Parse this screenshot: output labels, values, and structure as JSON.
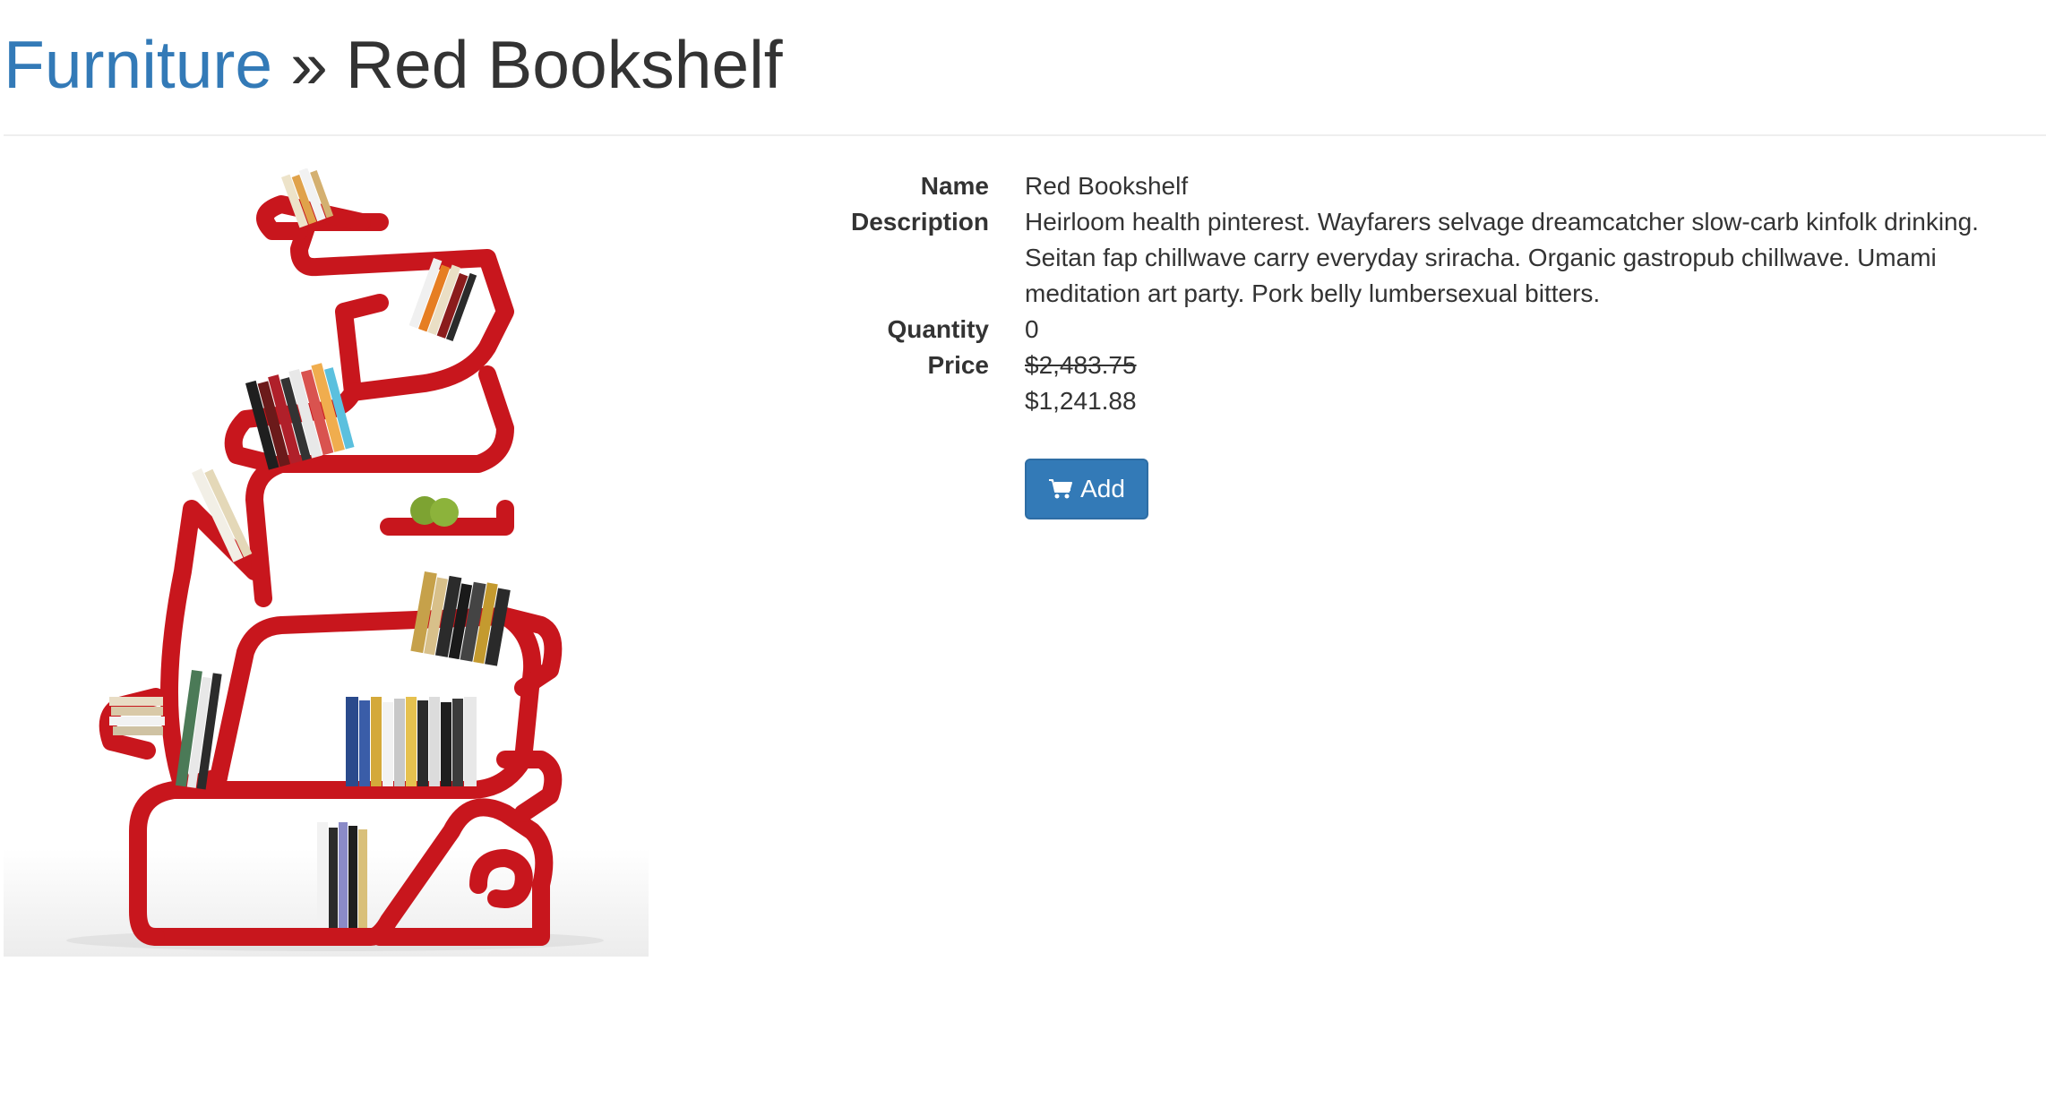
{
  "breadcrumb": {
    "parent_label": "Furniture",
    "separator": "»",
    "current_label": "Red Bookshelf"
  },
  "product": {
    "image_alt": "Red Bookshelf",
    "fields": {
      "name_label": "Name",
      "name_value": "Red Bookshelf",
      "description_label": "Description",
      "description_value": "Heirloom health pinterest. Wayfarers selvage dreamcatcher slow-carb kinfolk drinking. Seitan fap chillwave carry everyday sriracha. Organic gastropub chillwave. Umami meditation art party. Pork belly lumbersexual bitters.",
      "quantity_label": "Quantity",
      "quantity_value": "0",
      "price_label": "Price",
      "original_price": "$2,483.75",
      "sale_price": "$1,241.88"
    },
    "add_button_label": "Add",
    "add_button_icon": "shopping-cart-icon"
  },
  "colors": {
    "link": "#337ab7",
    "button_bg": "#337ab7",
    "shelf_red": "#c8161d",
    "text": "#333333"
  }
}
